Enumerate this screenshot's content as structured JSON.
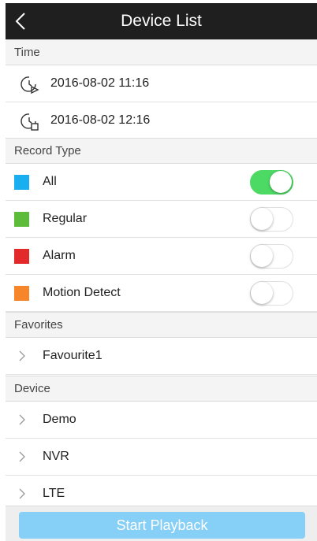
{
  "navbar": {
    "title": "Device List",
    "back_icon": "chevron-left-icon"
  },
  "time": {
    "header": "Time",
    "start": {
      "value": "2016-08-02 11:16",
      "icon": "clock-play-icon"
    },
    "end": {
      "value": "2016-08-02 12:16",
      "icon": "clock-stop-icon"
    }
  },
  "record_type": {
    "header": "Record Type",
    "items": [
      {
        "label": "All",
        "color": "#19aef0",
        "enabled": true
      },
      {
        "label": "Regular",
        "color": "#5dbd3a",
        "enabled": false
      },
      {
        "label": "Alarm",
        "color": "#e32a2a",
        "enabled": false
      },
      {
        "label": "Motion Detect",
        "color": "#f7862a",
        "enabled": false
      }
    ]
  },
  "favorites": {
    "header": "Favorites",
    "items": [
      {
        "label": "Favourite1"
      }
    ]
  },
  "device": {
    "header": "Device",
    "items": [
      {
        "label": "Demo"
      },
      {
        "label": "NVR"
      },
      {
        "label": "LTE"
      }
    ]
  },
  "footer": {
    "start_label": "Start Playback",
    "button_color": "#86cff6"
  }
}
